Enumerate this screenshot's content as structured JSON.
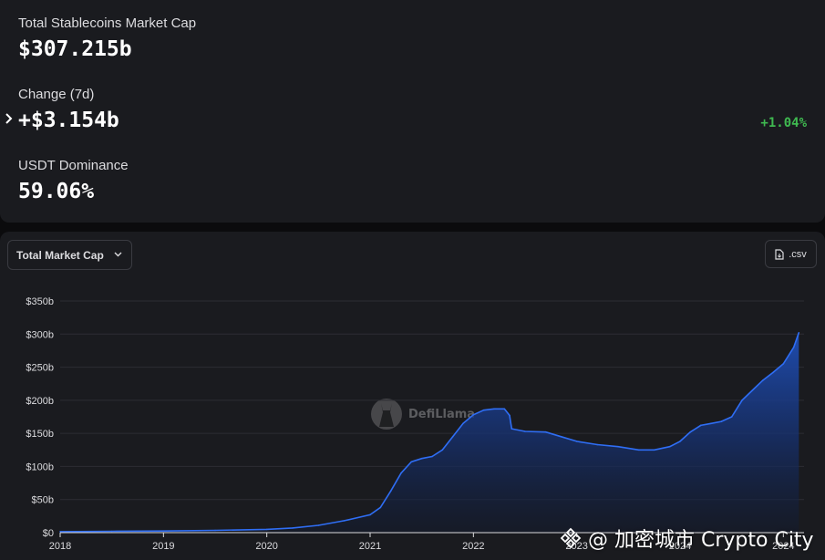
{
  "stats": {
    "market_cap_label": "Total Stablecoins Market Cap",
    "market_cap_value": "$307.215b",
    "change_label": "Change (7d)",
    "change_value": "+$3.154b",
    "change_pct": "+1.04%",
    "dominance_label": "USDT Dominance",
    "dominance_value": "59.06%"
  },
  "controls": {
    "dropdown_label": "Total Market Cap",
    "csv_label": ".csv"
  },
  "watermarks": {
    "defillama": "DefiLlama",
    "credit": "@ 加密城市 Crypto City"
  },
  "colors": {
    "line": "#2f6ef5",
    "positive": "#3fb950",
    "background": "#1a1b1f"
  },
  "chart_data": {
    "type": "area",
    "xlabel": "",
    "ylabel": "",
    "ylim": [
      0,
      350
    ],
    "xlim": [
      2018.0,
      2025.2
    ],
    "yticks": [
      "$0",
      "$50b",
      "$100b",
      "$150b",
      "$200b",
      "$250b",
      "$300b",
      "$350b"
    ],
    "ytick_values": [
      0,
      50,
      100,
      150,
      200,
      250,
      300,
      350
    ],
    "xticks": [
      "2018",
      "2019",
      "2020",
      "2021",
      "2022",
      "2023",
      "2024",
      "2024"
    ],
    "xtick_values": [
      2018,
      2019,
      2020,
      2021,
      2022,
      2023,
      2024,
      2025
    ],
    "grid": true,
    "series": [
      {
        "x": [
          2018.0,
          2018.5,
          2019.0,
          2019.5,
          2020.0,
          2020.25,
          2020.5,
          2020.75,
          2021.0,
          2021.1,
          2021.2,
          2021.3,
          2021.4,
          2021.5,
          2021.6,
          2021.7,
          2021.8,
          2021.9,
          2022.0,
          2022.1,
          2022.2,
          2022.3,
          2022.35,
          2022.37,
          2022.5,
          2022.7,
          2022.85,
          2023.0,
          2023.2,
          2023.4,
          2023.6,
          2023.75,
          2023.9,
          2024.0,
          2024.1,
          2024.2,
          2024.3,
          2024.4,
          2024.5,
          2024.6,
          2024.7,
          2024.8,
          2024.9,
          2025.0,
          2025.1,
          2025.15
        ],
        "values": [
          1.5,
          2,
          2.5,
          3.5,
          5,
          7,
          11,
          18,
          27,
          38,
          63,
          90,
          107,
          112,
          115,
          125,
          145,
          165,
          178,
          185,
          187,
          187,
          177,
          157,
          153,
          152,
          145,
          138,
          133,
          130,
          125,
          125,
          130,
          138,
          152,
          162,
          165,
          168,
          175,
          200,
          215,
          230,
          242,
          255,
          280,
          302
        ]
      }
    ]
  }
}
